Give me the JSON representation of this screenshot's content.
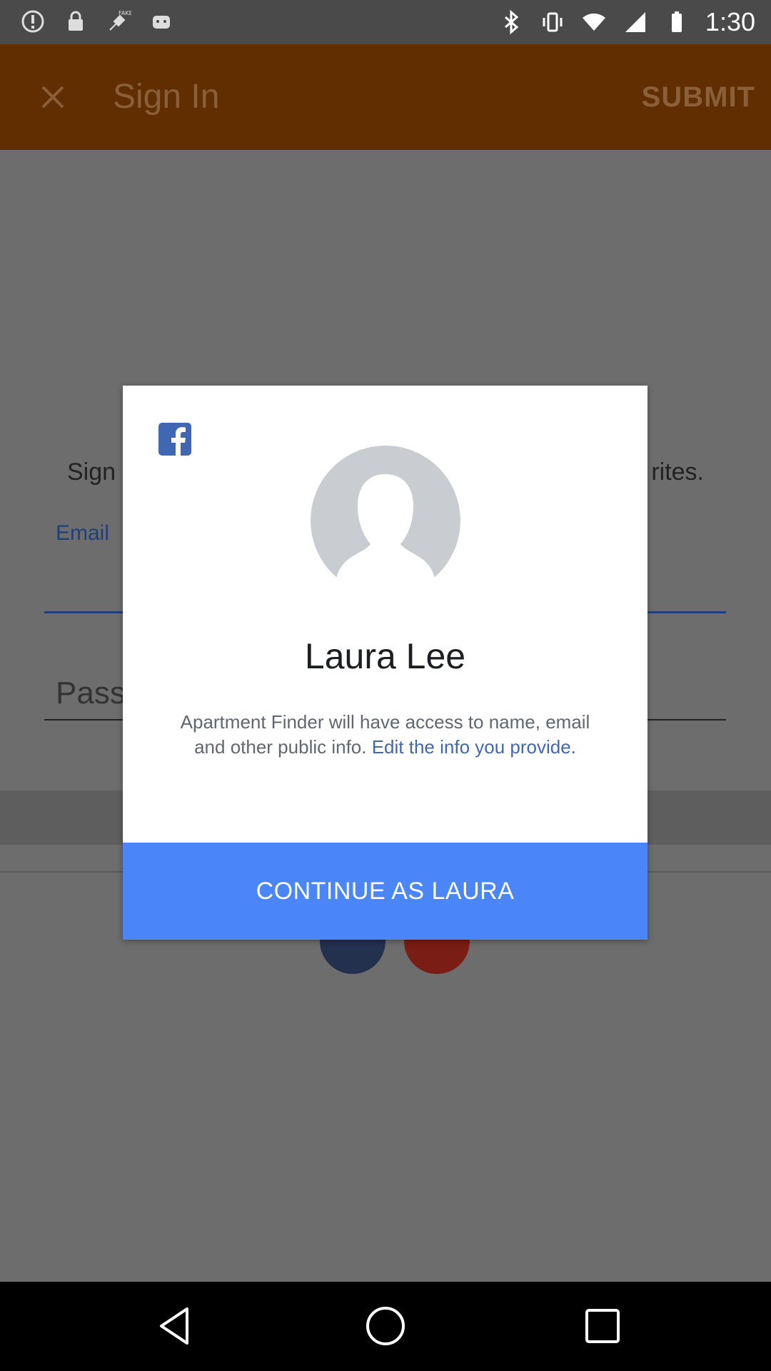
{
  "status_bar": {
    "time": "1:30",
    "left_icons": [
      "alert-circle-icon",
      "lock-icon",
      "fake-gps-icon",
      "android-icon"
    ],
    "right_icons": [
      "bluetooth-icon",
      "vibrate-icon",
      "wifi-icon",
      "signal-icon",
      "battery-icon"
    ]
  },
  "app_bar": {
    "title": "Sign In",
    "submit_label": "SUBMIT",
    "close_icon": "close-icon",
    "color": "#602e00"
  },
  "background_form": {
    "intro_left": "Sign",
    "intro_right": "rites.",
    "email_label": "Email",
    "password_placeholder": "Pass",
    "social_buttons": [
      "facebook-icon",
      "google-plus-icon"
    ]
  },
  "dialog": {
    "provider_icon": "facebook-icon",
    "user_name": "Laura Lee",
    "description": "Apartment Finder will have access to name, email and other public info. ",
    "edit_link": "Edit the info you provide.",
    "continue_label": "CONTINUE AS LAURA",
    "accent_color": "#4a86f7"
  },
  "nav_bar": {
    "buttons": [
      "back-icon",
      "home-icon",
      "recents-icon"
    ]
  }
}
